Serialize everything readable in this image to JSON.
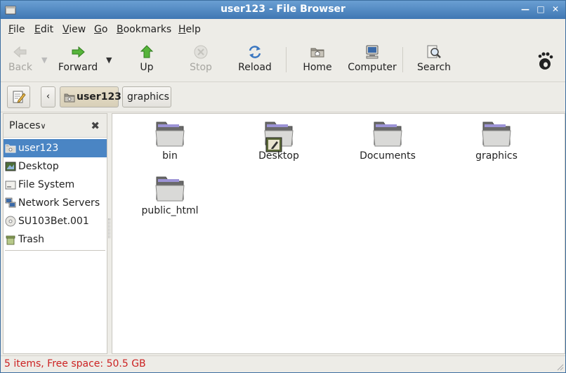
{
  "window": {
    "title": "user123 - File Browser"
  },
  "menu": {
    "items": [
      {
        "key": "F",
        "rest": "ile"
      },
      {
        "key": "E",
        "rest": "dit"
      },
      {
        "key": "V",
        "rest": "iew"
      },
      {
        "key": "G",
        "rest": "o"
      },
      {
        "key": "B",
        "rest": "ookmarks"
      },
      {
        "key": "H",
        "rest": "elp"
      }
    ]
  },
  "toolbar": {
    "back": {
      "label": "Back",
      "icon": "back-arrow-icon",
      "enabled": false
    },
    "forward": {
      "label": "Forward",
      "icon": "forward-arrow-icon",
      "enabled": true
    },
    "up": {
      "label": "Up",
      "icon": "up-arrow-icon",
      "enabled": true
    },
    "stop": {
      "label": "Stop",
      "icon": "stop-icon",
      "enabled": false
    },
    "reload": {
      "label": "Reload",
      "icon": "reload-icon",
      "enabled": true
    },
    "home": {
      "label": "Home",
      "icon": "home-folder-icon",
      "enabled": true
    },
    "computer": {
      "label": "Computer",
      "icon": "computer-icon",
      "enabled": true
    },
    "search": {
      "label": "Search",
      "icon": "search-icon",
      "enabled": true
    }
  },
  "location": {
    "crumbs": [
      {
        "label": "user123",
        "active": true
      },
      {
        "label": "graphics",
        "active": false
      }
    ]
  },
  "sidebar": {
    "header": "Places",
    "items": [
      {
        "label": "user123",
        "icon": "home-folder-icon",
        "selected": true
      },
      {
        "label": "Desktop",
        "icon": "desktop-icon",
        "selected": false
      },
      {
        "label": "File System",
        "icon": "drive-icon",
        "selected": false
      },
      {
        "label": "Network Servers",
        "icon": "network-icon",
        "selected": false
      },
      {
        "label": "SU103Bet.001",
        "icon": "disc-icon",
        "selected": false
      },
      {
        "label": "Trash",
        "icon": "trash-icon",
        "selected": false
      }
    ]
  },
  "files": [
    {
      "name": "bin",
      "icon": "folder-icon"
    },
    {
      "name": "Desktop",
      "icon": "desktop-folder-icon"
    },
    {
      "name": "Documents",
      "icon": "folder-icon"
    },
    {
      "name": "graphics",
      "icon": "folder-icon"
    },
    {
      "name": "public_html",
      "icon": "folder-icon"
    }
  ],
  "status": {
    "text": "5 items, Free space: 50.5 GB"
  },
  "colors": {
    "selection": "#4a85c4",
    "titlebar": "#3f77b3",
    "status_text": "#cc2222"
  }
}
